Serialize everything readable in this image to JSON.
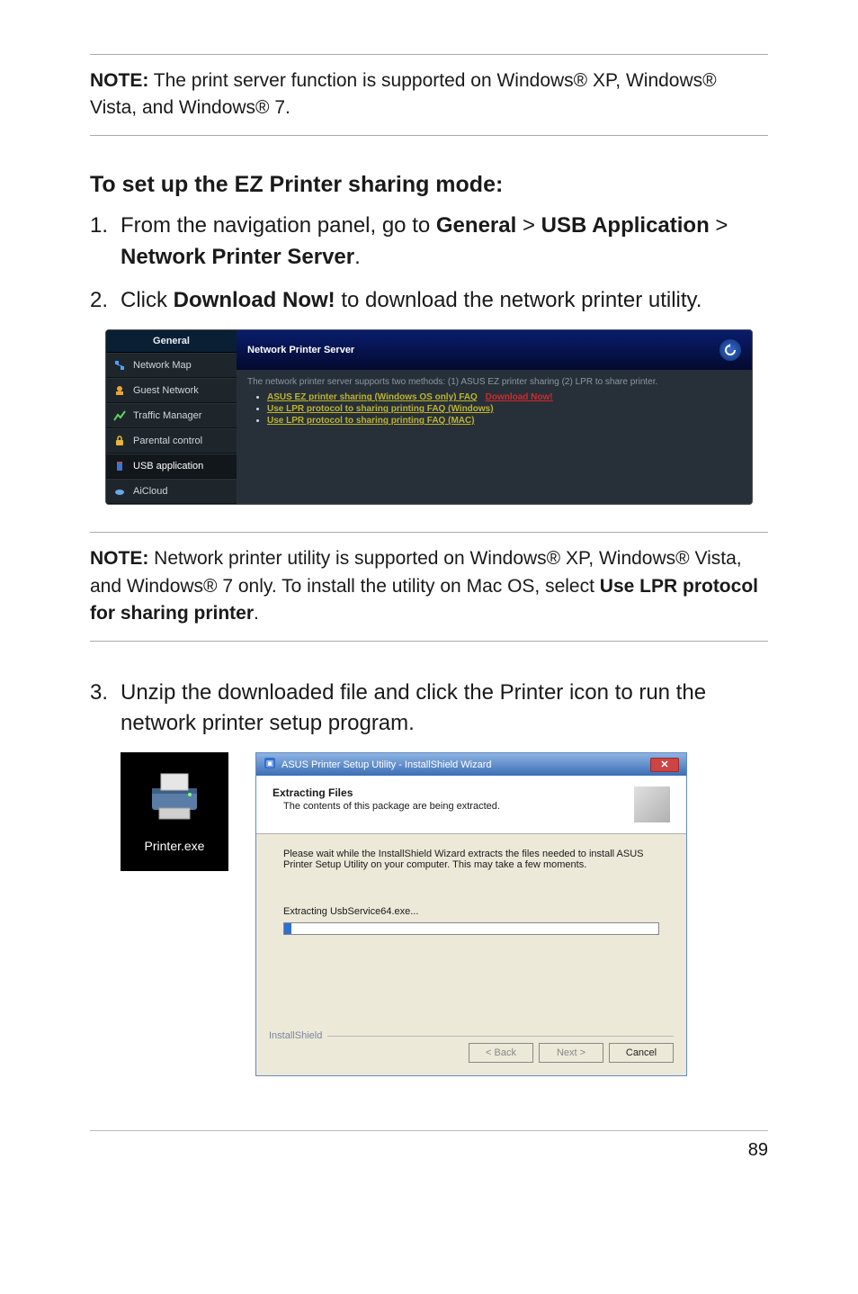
{
  "notes": {
    "note1_label": "NOTE:",
    "note1_text": "  The print server function is supported on Windows® XP, Windows® Vista, and Windows® 7.",
    "note2_label": "NOTE:",
    "note2_text_a": " Network printer utility is supported on Windows® XP, Windows® Vista, and Windows® 7 only. To install the utility on Mac OS, select ",
    "note2_text_b": "Use LPR protocol for sharing printer",
    "note2_text_c": "."
  },
  "heading": "To set up the EZ Printer sharing mode:",
  "steps": {
    "s1_a": "From the navigation panel, go to ",
    "s1_b": "General",
    "s1_c": "USB Application",
    "s1_d": "Network Printer Server",
    "gt": " > ",
    "period": ".",
    "s2_a": "Click ",
    "s2_b": "Download Now!",
    "s2_c": " to download the network printer utility.",
    "s3": "Unzip the downloaded file and click the Printer icon to run the network printer setup program."
  },
  "router": {
    "side_head": "General",
    "items": [
      "Network Map",
      "Guest Network",
      "Traffic Manager",
      "Parental control",
      "USB application",
      "AiCloud"
    ],
    "title": "Network Printer Server",
    "desc": "The network printer server supports two methods: (1) ASUS EZ printer sharing (2) LPR to share printer.",
    "faq1": "ASUS EZ printer sharing (Windows OS only) FAQ",
    "dl": "Download Now!",
    "faq2": "Use LPR protocol to sharing printing FAQ (Windows)",
    "faq3": "Use LPR protocol to sharing printing FAQ (MAC)"
  },
  "printer_exe": "Printer.exe",
  "wizard": {
    "title": "ASUS Printer Setup Utility - InstallShield Wizard",
    "head_b": "Extracting Files",
    "head_t": "The contents of this package are being extracted.",
    "body_text": "Please wait while the InstallShield Wizard extracts the files needed to install ASUS Printer Setup Utility on your computer.  This may take a few moments.",
    "extracting": "Extracting UsbService64.exe...",
    "fieldset": "InstallShield",
    "back": "< Back",
    "next": "Next >",
    "cancel": "Cancel"
  },
  "page_num": "89"
}
